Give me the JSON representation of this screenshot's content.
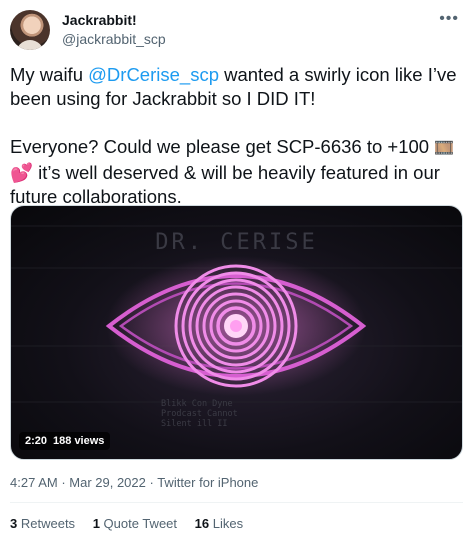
{
  "author": {
    "name": "Jackrabbit!",
    "handle": "@jackrabbit_scp",
    "more_icon": "more-horizontal-icon"
  },
  "tweet": {
    "line1_before": "My waifu ",
    "mention": "@DrCerise_scp",
    "line1_after": " wanted a swirly icon like I’ve been using for Jackrabbit so I DID IT!",
    "line2_before": "Everyone? Could we please get SCP-6636 to +100 ",
    "film_emoji": "🎞️",
    "heart_emoji": "💕",
    "line2_after": " it’s well deserved & will be heavily featured in our future collaborations."
  },
  "video": {
    "title_text": "DR. CERISE",
    "caption_lines": [
      "Blikk Con Dyne",
      "Prodcast Cannot",
      "Silent ill II"
    ],
    "duration": "2:20",
    "views": "188 views"
  },
  "meta": {
    "time": "4:27 AM",
    "date": "Mar 29, 2022",
    "source": "Twitter for iPhone"
  },
  "stats": {
    "retweets_count": "3",
    "retweets_label": "Retweets",
    "quotes_count": "1",
    "quotes_label": "Quote Tweet",
    "likes_count": "16",
    "likes_label": "Likes"
  },
  "colors": {
    "link": "#1d9bf0",
    "muted": "#536471",
    "eye_pink": "#e15ad6"
  }
}
